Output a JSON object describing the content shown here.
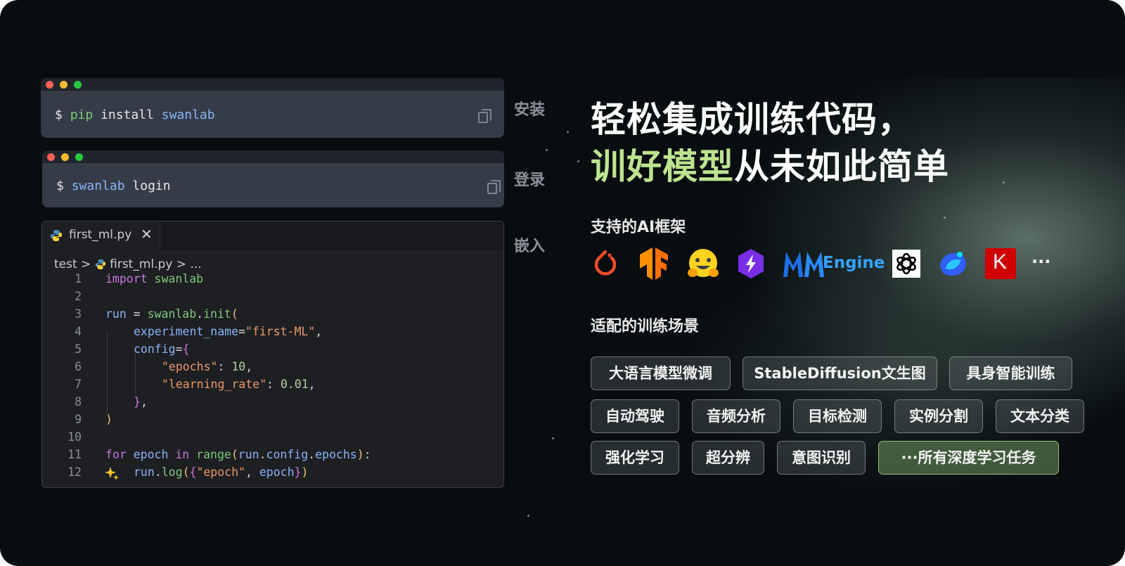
{
  "install": {
    "prompt": "$",
    "cmd_pip": "pip",
    "cmd_install": "install",
    "cmd_pkg": "swanlab",
    "step_label": "安装"
  },
  "login": {
    "prompt": "$",
    "cmd_pkg": "swanlab",
    "cmd_login": "login",
    "step_label": "登录"
  },
  "embed": {
    "step_label": "嵌入"
  },
  "editor": {
    "tab_name": "first_ml.py",
    "tab_close": "✕",
    "breadcrumb": {
      "folder": "test",
      "sep1": ">",
      "file": "first_ml.py",
      "sep2": ">",
      "rest": "..."
    },
    "line_numbers": [
      "1",
      "2",
      "3",
      "4",
      "5",
      "6",
      "7",
      "8",
      "9",
      "10",
      "11",
      "12"
    ],
    "code": {
      "l1_kw": "import",
      "l1_mod": "swanlab",
      "l3_var": "run",
      "l3_eq": " = ",
      "l3_mod": "swanlab",
      "l3_dot": ".",
      "l3_fn": "init",
      "l3_paren": "(",
      "l4_key": "experiment_name",
      "l4_eq": "=",
      "l4_val": "\"first-ML\"",
      "l4_comma": ",",
      "l5_key": "config",
      "l5_eq": "=",
      "l5_brace": "{",
      "l6_key": "\"epochs\"",
      "l6_colon": ": ",
      "l6_val": "10",
      "l6_comma": ",",
      "l7_key": "\"learning_rate\"",
      "l7_colon": ": ",
      "l7_val": "0.01",
      "l7_comma": ",",
      "l8_brace": "}",
      "l8_comma": ",",
      "l9_paren": ")",
      "l11_for": "for",
      "l11_var": "epoch",
      "l11_in": "in",
      "l11_fn": "range",
      "l11_open": "(",
      "l11_run": "run",
      "l11_dot1": ".",
      "l11_cfg": "config",
      "l11_dot2": ".",
      "l11_ep": "epochs",
      "l11_close": ")",
      "l11_colon": ":",
      "l12_run": "run",
      "l12_dot": ".",
      "l12_fn": "log",
      "l12_open": "(",
      "l12_brace_open": "{",
      "l12_key": "\"epoch\"",
      "l12_comma": ", ",
      "l12_var": "epoch",
      "l12_brace_close": "}",
      "l12_close": ")"
    }
  },
  "headline": {
    "line1": "轻松集成训练代码，",
    "line2_highlight": "训好模型",
    "line2_rest": "从未如此简单"
  },
  "frameworks": {
    "title": "支持的AI框架",
    "logos": [
      "pytorch-icon",
      "tensorflow-icon",
      "huggingface-icon",
      "lightning-icon",
      "mmengine-logo",
      "openai-icon",
      "volcengine-icon",
      "keras-icon"
    ],
    "mmengine_text": "Engine",
    "keras_letter": "K",
    "more": "···"
  },
  "scenarios": {
    "title": "适配的训练场景",
    "row1": [
      "大语言模型微调",
      "StableDiffusion文生图",
      "具身智能训练"
    ],
    "row2": [
      "自动驾驶",
      "音频分析",
      "目标检测",
      "实例分割",
      "文本分类"
    ],
    "row3": [
      "强化学习",
      "超分辨",
      "意图识别",
      "···所有深度学习任务"
    ]
  },
  "colors": {
    "accent_green": "#bde38f",
    "background": "#080d10",
    "terminal": "#353c47"
  }
}
